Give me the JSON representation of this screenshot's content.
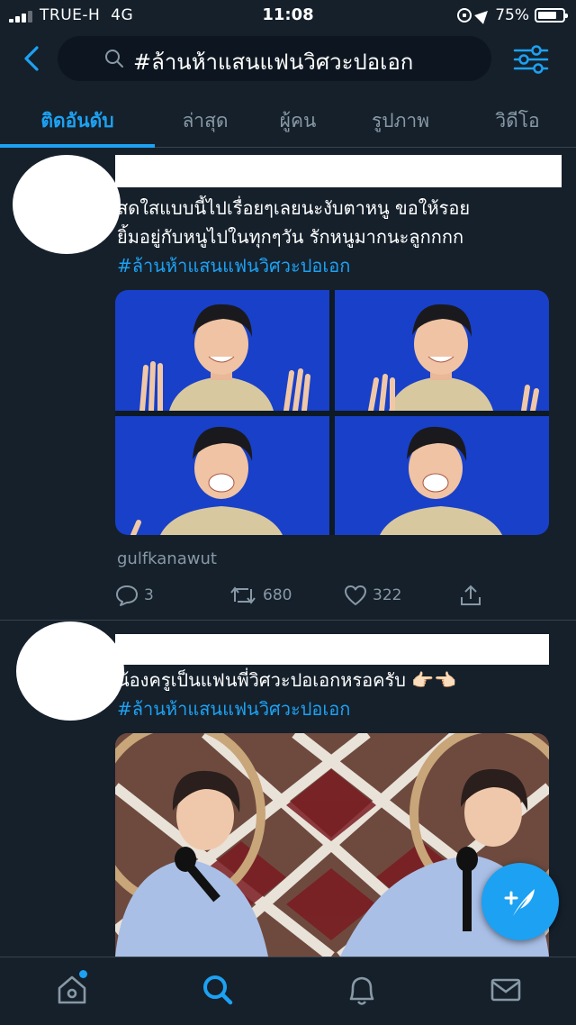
{
  "status_bar": {
    "carrier": "TRUE-H",
    "network": "4G",
    "time": "11:08",
    "battery_percent": "75%",
    "battery_level": 0.75
  },
  "search": {
    "query": "#ล้านห้าแสนแฟนวิศวะปอเอก"
  },
  "tabs": [
    {
      "label": "ติดอันดับ",
      "active": true
    },
    {
      "label": "ล่าสุด",
      "active": false
    },
    {
      "label": "ผู้คน",
      "active": false
    },
    {
      "label": "รูปภาพ",
      "active": false
    },
    {
      "label": "วิดีโอ",
      "active": false
    }
  ],
  "tweets": [
    {
      "text_lines": [
        "สดใสแบบนี้ไปเรื่อยๆเลยนะงับตาหนู ขอให้รอย",
        "ยิ้มอยู่กับหนูไปในทุกๆวัน รักหนูมากนะลูกกกก"
      ],
      "hashtag": "#ล้านห้าแสนแฟนวิศวะปอเอก",
      "source": "gulfkanawut",
      "replies": "3",
      "retweets": "680",
      "likes": "322"
    },
    {
      "text_lines": [
        "น้องครูเป็นแฟนพี่วิศวะปอเอกหรอครับ 👉🏻👈🏻"
      ],
      "hashtag": "#ล้านห้าแสนแฟนวิศวะปอเอก"
    }
  ],
  "colors": {
    "background": "#15202b",
    "accent": "#1da1f2",
    "muted": "#8899a6",
    "divider": "#38444d"
  },
  "icons": {
    "back": "chevron-left-icon",
    "search": "search-icon",
    "filter": "sliders-icon",
    "reply": "comment-icon",
    "retweet": "retweet-icon",
    "like": "heart-icon",
    "share": "share-icon",
    "compose": "feather-plus-icon",
    "home": "home-icon",
    "explore": "search-icon",
    "notifications": "bell-icon",
    "messages": "mail-icon"
  }
}
